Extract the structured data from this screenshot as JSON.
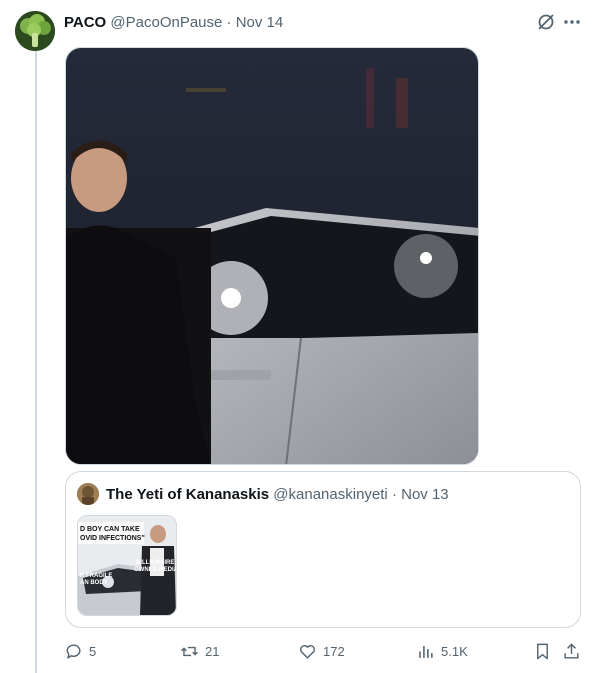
{
  "post": {
    "display_name": "PACO",
    "handle": "@PacoOnPause",
    "separator": "·",
    "date": "Nov 14"
  },
  "quoted": {
    "display_name": "The Yeti of Kananaskis",
    "handle": "@kananaskinyeti",
    "separator": "·",
    "date": "Nov 13",
    "meme_text": {
      "top": "D BOY CAN TAKE COVID INFECTIONS\"",
      "right": "BILLIONAIRE OWNED MEDIA",
      "left": "R FRAGILE AN BODY"
    }
  },
  "actions": {
    "replies": "5",
    "reposts": "21",
    "likes": "172",
    "views": "5.1K"
  },
  "icons": [
    "grok-icon",
    "more-icon",
    "reply-icon",
    "repost-icon",
    "like-icon",
    "views-icon",
    "bookmark-icon",
    "share-icon"
  ],
  "colors": {
    "muted": "#536471",
    "border": "#cfd9de",
    "text": "#0f1419"
  }
}
